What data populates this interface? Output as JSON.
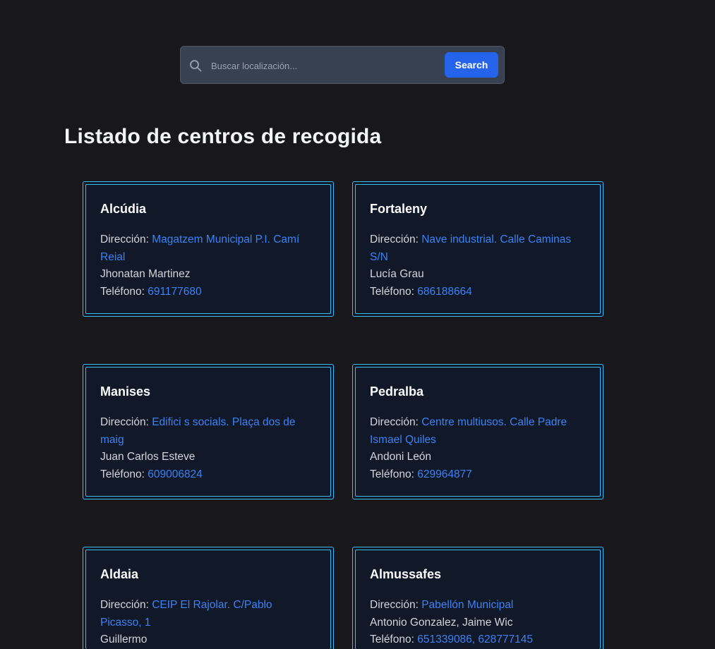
{
  "search": {
    "placeholder": "Buscar localización...",
    "button_label": "Search"
  },
  "page": {
    "title": "Listado de centros de recogida"
  },
  "labels": {
    "address": "Dirección: ",
    "phone": "Teléfono: "
  },
  "centers": [
    {
      "name": "Alcúdia",
      "address": "Magatzem Municipal P.I. Camí Reial",
      "contact": "Jhonatan Martinez",
      "phone": "691177680"
    },
    {
      "name": "Fortaleny",
      "address": "Nave industrial. Calle Caminas S/N",
      "contact": "Lucía Grau",
      "phone": "686188664"
    },
    {
      "name": "Manises",
      "address": "Edifici s socials. Plaça dos de maig",
      "contact": "Juan Carlos Esteve",
      "phone": "609006824"
    },
    {
      "name": "Pedralba",
      "address": "Centre multiusos. Calle Padre Ismael Quiles",
      "contact": "Andoni León",
      "phone": "629964877"
    },
    {
      "name": "Aldaia",
      "address": "CEIP El Rajolar. C/Pablo Picasso, 1",
      "contact": "Guillermo",
      "phone": ""
    },
    {
      "name": "Almussafes",
      "address": "Pabellón Municipal",
      "contact": "Antonio Gonzalez, Jaime Wic",
      "phone": "651339086, 628777145"
    }
  ],
  "colors": {
    "background": "#17171c",
    "card_background": "#111827",
    "card_border": "#38bdf8",
    "link": "#3b82f6",
    "button": "#2563eb"
  },
  "icons": {
    "search": "search-icon"
  }
}
